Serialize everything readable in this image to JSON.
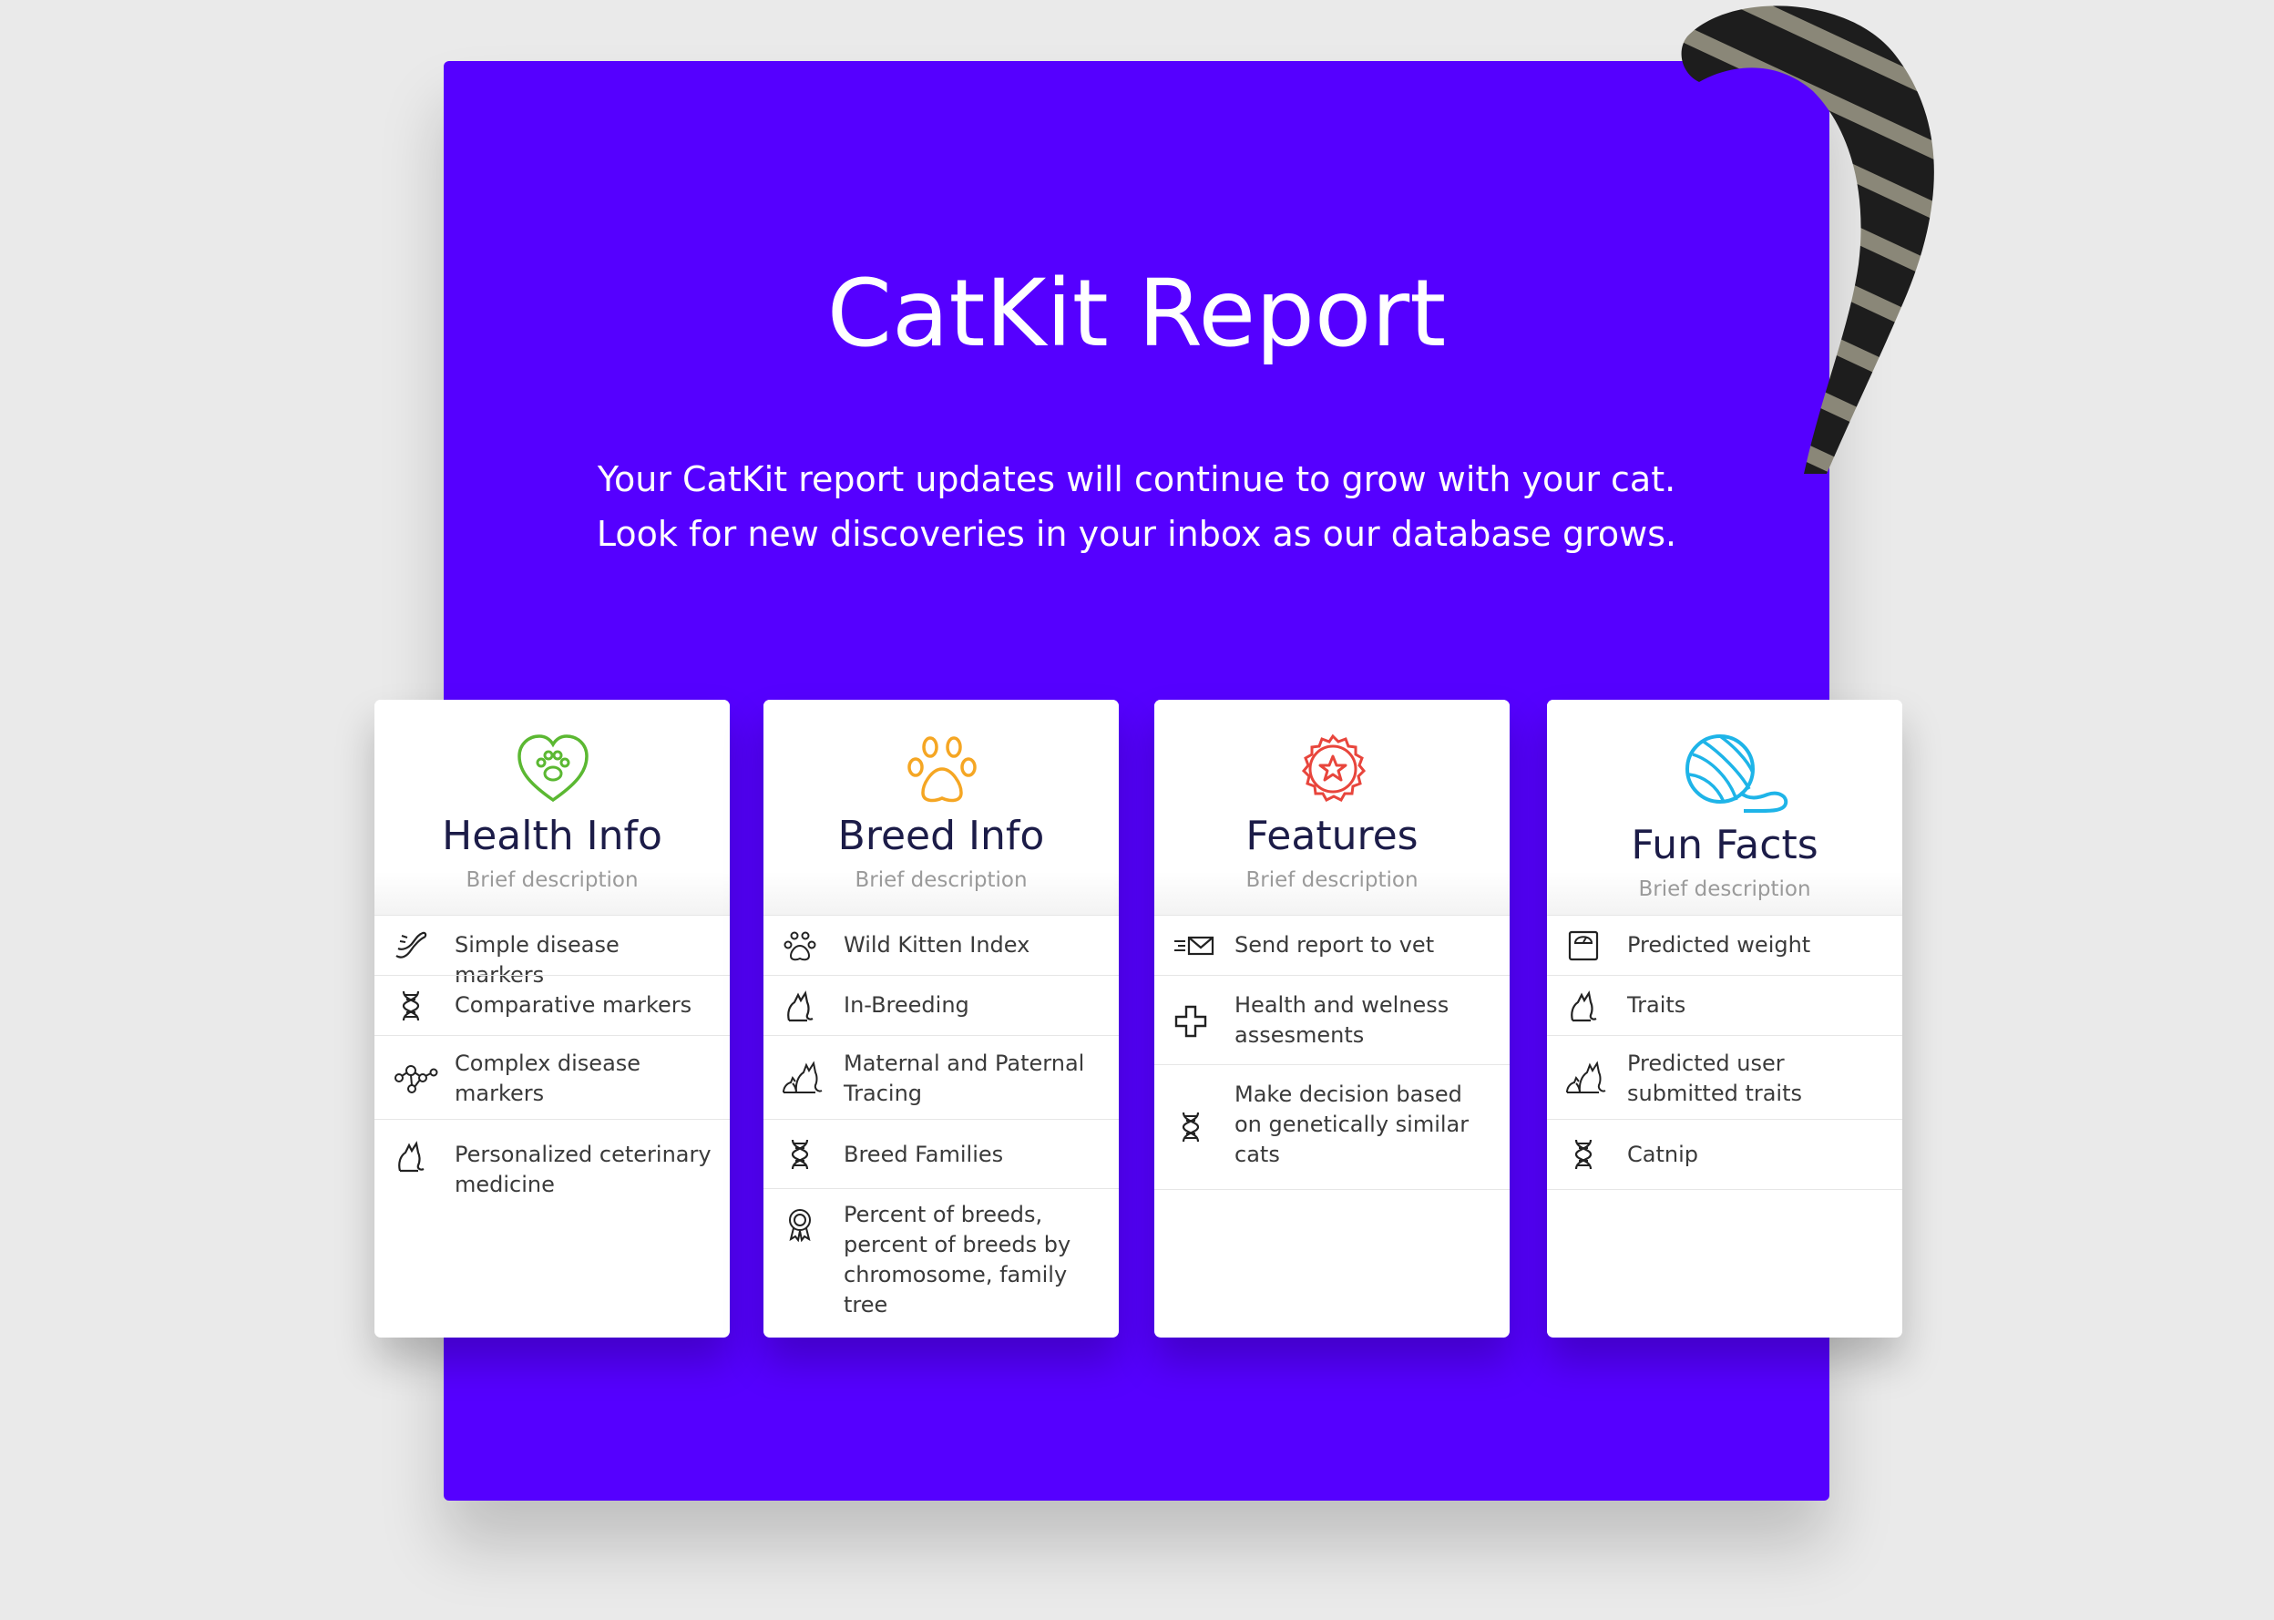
{
  "colors": {
    "background": "#eaeaea",
    "panel": "#5500ff",
    "card": "#ffffff",
    "heading": "#1c1c48",
    "health_icon": "#5bb832",
    "breed_icon": "#f5a623",
    "features_icon": "#e8453c",
    "fun_icon": "#1eb4e8"
  },
  "header": {
    "title": "CatKit Report",
    "subtitle_line1": "Your CatKit report updates will continue to grow with your cat.",
    "subtitle_line2": "Look for new discoveries in your inbox as our database grows."
  },
  "cards": [
    {
      "title": "Health Info",
      "description": "Brief description",
      "icon": "heart-paw-icon",
      "items": [
        {
          "icon": "worm-icon",
          "label": "Simple disease markers"
        },
        {
          "icon": "dna-icon",
          "label": "Comparative markers"
        },
        {
          "icon": "molecule-icon",
          "label": "Complex disease markers"
        },
        {
          "icon": "cat-icon",
          "label": "Personalized ceterinary medicine"
        }
      ]
    },
    {
      "title": "Breed Info",
      "description": "Brief description",
      "icon": "paw-icon",
      "items": [
        {
          "icon": "paw-icon",
          "label": "Wild Kitten Index"
        },
        {
          "icon": "cat-icon",
          "label": "In-Breeding"
        },
        {
          "icon": "cat-family-icon",
          "label": "Maternal and Paternal Tracing"
        },
        {
          "icon": "dna-icon",
          "label": "Breed Families"
        },
        {
          "icon": "award-icon",
          "label": "Percent of breeds, percent of breeds by chromosome, family tree"
        }
      ]
    },
    {
      "title": "Features",
      "description": "Brief description",
      "icon": "star-badge-icon",
      "items": [
        {
          "icon": "send-mail-icon",
          "label": "Send report to vet"
        },
        {
          "icon": "medical-cross-icon",
          "label": "Health and welness assesments"
        },
        {
          "icon": "dna-icon",
          "label": "Make decision based on genetically similar cats"
        }
      ]
    },
    {
      "title": "Fun Facts",
      "description": "Brief description",
      "icon": "yarn-ball-icon",
      "items": [
        {
          "icon": "scale-icon",
          "label": "Predicted weight"
        },
        {
          "icon": "cat-icon",
          "label": "Traits"
        },
        {
          "icon": "cat-family-icon",
          "label": "Predicted user submitted traits"
        },
        {
          "icon": "dna-icon",
          "label": "Catnip"
        }
      ]
    }
  ]
}
